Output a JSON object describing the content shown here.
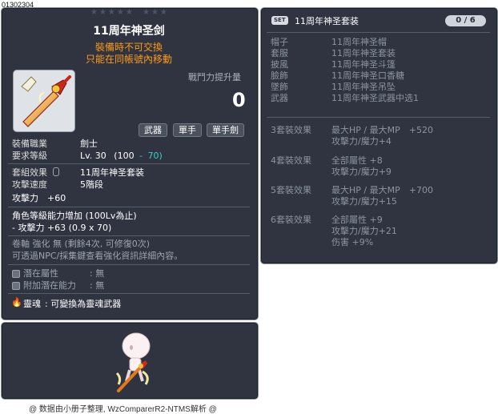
{
  "item_id": "01302304",
  "tooltip": {
    "stars_left": "★★★★★",
    "stars_right": "★★★",
    "title": "11周年神圣剑",
    "warning1": "裝備時不可交換",
    "warning2": "只能在同帳號內移動",
    "power_label": "戰鬥力提升量",
    "power_value": "0",
    "tags": [
      "武器",
      "單手",
      "單手劍"
    ],
    "job_label": "裝備職業",
    "job_value": "劍士",
    "req_label": "要求等級",
    "req_value": "Lv. 30",
    "req_base": "(100",
    "req_dash": "-",
    "req_add": "70)",
    "set_label": "套組效果",
    "set_value": "11周年神圣套装",
    "speed_label": "攻擊速度",
    "speed_value": "5階段",
    "atk_line": "攻擊力　+60",
    "growth_line1": "角色等級能力增加 (100Lv為止)",
    "growth_line2": "- 攻擊力 +63 (0.9 x 70)",
    "enhance_line1": "卷軸 強化 無 (剩餘4次, 可修復0次)",
    "enhance_line2": "可透過NPC/採集鍵查看強化資訊詳細內容。",
    "potential_label": "潛在屬性",
    "potential_value": ": 無",
    "addpot_label": "附加潛在能力",
    "addpot_value": ": 無",
    "soul_label": "靈魂",
    "soul_value": ": 可變換為靈魂武器"
  },
  "set_panel": {
    "badge": "SET",
    "name": "11周年神圣套装",
    "count": "0 / 6",
    "items": [
      {
        "slot": "帽子",
        "name": "11周年神圣帽"
      },
      {
        "slot": "套服",
        "name": "11周年神圣套装"
      },
      {
        "slot": "披風",
        "name": "11周年神圣斗篷"
      },
      {
        "slot": "臉飾",
        "name": "11周年神圣口香糖"
      },
      {
        "slot": "墜飾",
        "name": "11周年神圣吊坠"
      },
      {
        "slot": "武器",
        "name": "11周年神圣武器中选1"
      }
    ],
    "effects": [
      {
        "label": "3套裝效果",
        "lines": [
          "最大HP / 最大MP　+520",
          "攻擊力/魔力+4"
        ]
      },
      {
        "label": "4套裝效果",
        "lines": [
          "全部屬性 +8",
          "攻擊力/魔力+9"
        ]
      },
      {
        "label": "5套裝效果",
        "lines": [
          "最大HP / 最大MP　+700",
          "攻擊力/魔力+15"
        ]
      },
      {
        "label": "6套裝效果",
        "lines": [
          "全部屬性 +9",
          "攻擊力/魔力+21",
          "伤害 +9%"
        ]
      }
    ]
  },
  "footer": "@ 数据由小册子整理, WzComparerR2-NTMS解析 @"
}
